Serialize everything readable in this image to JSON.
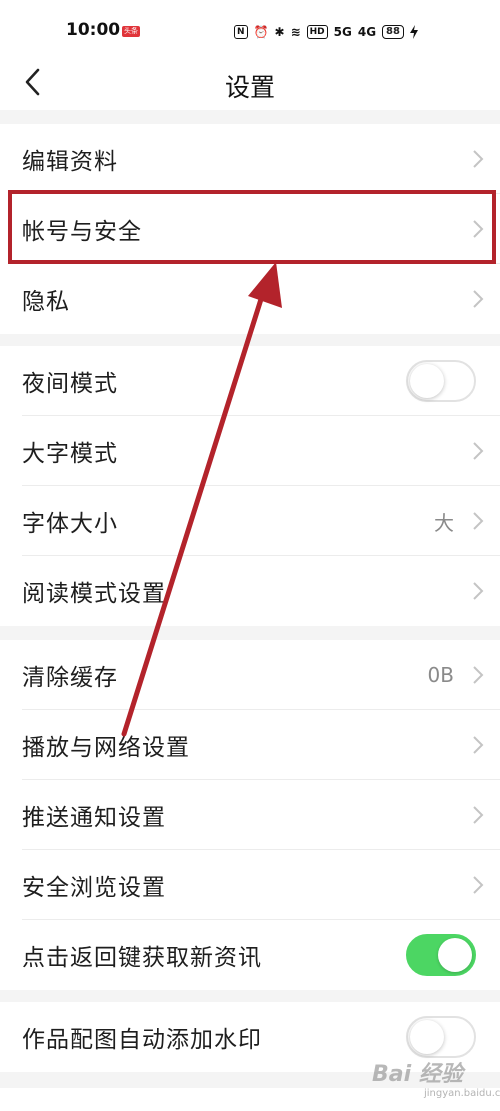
{
  "status": {
    "time": "10:00",
    "badge": "头条",
    "nfc": "N",
    "alarm": "⏰",
    "bluetooth": "✱",
    "wifi": "≋",
    "hd": "HD",
    "signal1": "5G",
    "signal2": "4G",
    "battery": "88"
  },
  "header": {
    "title": "设置",
    "back_icon": "chevron-left-icon"
  },
  "groups": [
    {
      "items": [
        {
          "label": "编辑资料"
        },
        {
          "label": "帐号与安全"
        },
        {
          "label": "隐私"
        }
      ]
    },
    {
      "items": [
        {
          "label": "夜间模式",
          "toggle": false
        },
        {
          "label": "大字模式"
        },
        {
          "label": "字体大小",
          "value": "大"
        },
        {
          "label": "阅读模式设置"
        }
      ]
    },
    {
      "items": [
        {
          "label": "清除缓存",
          "value": "0B"
        },
        {
          "label": "播放与网络设置"
        },
        {
          "label": "推送通知设置"
        },
        {
          "label": "安全浏览设置"
        },
        {
          "label": "点击返回键获取新资讯",
          "toggle": true
        }
      ]
    },
    {
      "items": [
        {
          "label": "作品配图自动添加水印",
          "toggle": false
        }
      ]
    }
  ],
  "colors": {
    "accent_green": "#4cd663",
    "annotation_red": "#b3232b"
  },
  "watermark": {
    "brand": "Bai 经验",
    "url": "jingyan.baidu.com"
  }
}
